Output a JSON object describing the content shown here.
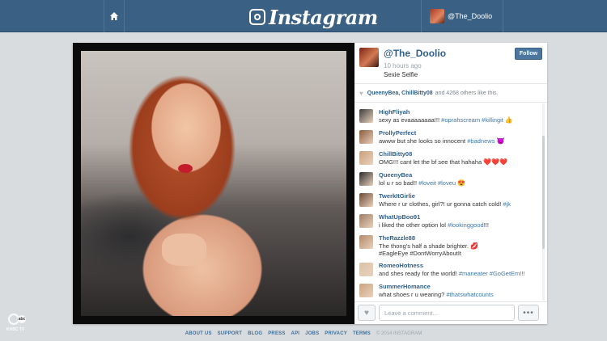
{
  "topbar": {
    "brand": "Instagram",
    "username": "@The_Doolio",
    "home_icon": "home-icon",
    "camera_icon": "camera-icon"
  },
  "post": {
    "owner": "@The_Doolio",
    "time": "10 hours ago",
    "caption": "Sexie Selfie",
    "follow_label": "Follow",
    "likes": {
      "names": "QueenyBea, ChillBitty08",
      "rest": "and 4268 others like this."
    }
  },
  "comments": [
    {
      "user": "HighFliyah",
      "text": "sexy as evaaaaaaaa!!!",
      "tags": "#oprahscream #killingit",
      "emoji": "👍",
      "avatar_color": "#3c3c3c"
    },
    {
      "user": "ProllyPerfect",
      "text": "awww but she looks so innocent",
      "tags": "#badnews",
      "emoji": "😈",
      "avatar_color": "#8a5a3b"
    },
    {
      "user": "ChillBitty08",
      "text": "OMG!!! cant let the bf see that hahaha",
      "tags": "",
      "emoji": "❤️❤️❤️",
      "avatar_color": "#c9a07a"
    },
    {
      "user": "QueenyBea",
      "text": "lol u r so bad!!",
      "tags": "#loveit #loveu",
      "emoji": "😍",
      "avatar_color": "#2b2b2b"
    },
    {
      "user": "TwerkItGirlie",
      "text": "Where r ur clothes, girl?! ur gonna catch cold!",
      "tags": "#jk",
      "emoji": "",
      "avatar_color": "#6b4a35"
    },
    {
      "user": "WhatUpBoo91",
      "text": "i liked the other option lol",
      "tags": "#lookinggood",
      "suffix": "!!!",
      "emoji": "",
      "avatar_color": "#9c7b62"
    },
    {
      "user": "TheRazzle88",
      "text": "The thong's half a shade brighter.",
      "tags": "",
      "line2": "#EagleEye #DontWorryAboutIt",
      "emoji": "💋",
      "avatar_color": "#b08968"
    },
    {
      "user": "RomeoHotness",
      "text": "and shes ready for the world!",
      "tags": "#maneater #GoGetEm!!!",
      "emoji": "",
      "avatar_color": "#d7c3a8"
    },
    {
      "user": "SummerHomance",
      "text": "what shoes r u wearing?",
      "tags": "#thatswhatcounts",
      "emoji": "",
      "avatar_color": "#caa27f"
    }
  ],
  "comment_bar": {
    "placeholder": "Leave a comment...",
    "more": "•••",
    "heart_icon": "heart-icon"
  },
  "footer": {
    "links": [
      "ABOUT US",
      "SUPPORT",
      "BLOG",
      "PRESS",
      "API",
      "JOBS",
      "PRIVACY",
      "TERMS"
    ],
    "copyright": "© 2014 INSTAGRAM"
  },
  "watermark": {
    "text": "KABC TV",
    "badge": "abc"
  }
}
